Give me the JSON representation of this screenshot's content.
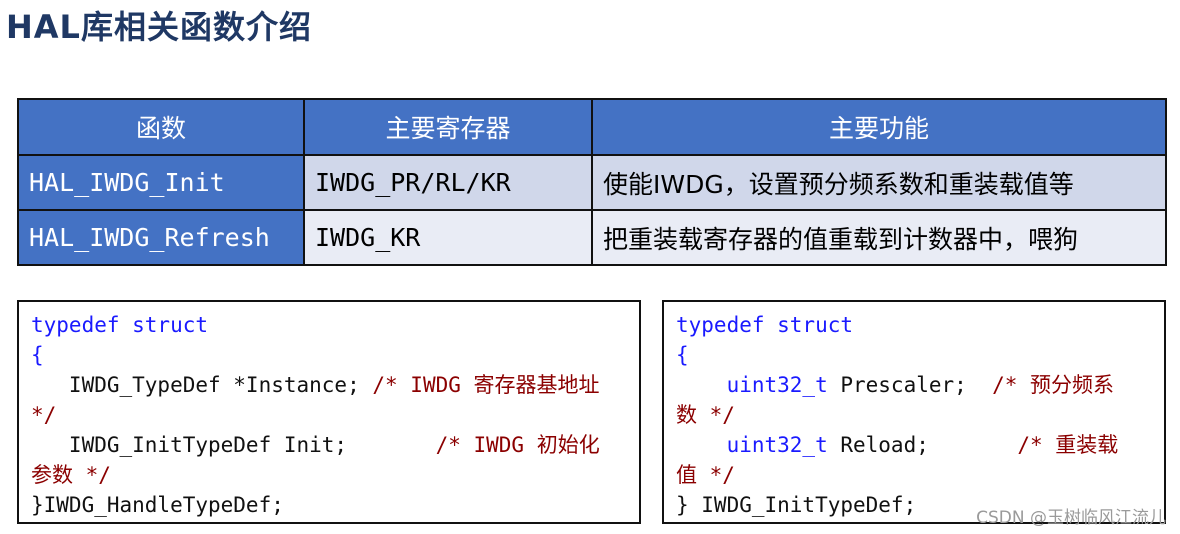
{
  "title": "HAL库相关函数介绍",
  "table": {
    "headers": [
      "函数",
      "主要寄存器",
      "主要功能"
    ],
    "rows": [
      [
        "HAL_IWDG_Init",
        "IWDG_PR/RL/KR",
        "使能IWDG，设置预分频系数和重装载值等"
      ],
      [
        "HAL_IWDG_Refresh",
        "IWDG_KR",
        "把重装载寄存器的值重载到计数器中，喂狗"
      ]
    ]
  },
  "code_left": {
    "l1_kw": "typedef struct",
    "l2": "{",
    "l3_code": "   IWDG_TypeDef *Instance; ",
    "l3_comment": "/* IWDG 寄存器基地址",
    "l4_comment": "*/",
    "l5_code": "   IWDG_InitTypeDef Init;       ",
    "l5_comment": "/* IWDG 初始化",
    "l6_comment": "参数 */",
    "l7": "}IWDG_HandleTypeDef;"
  },
  "code_right": {
    "l1_kw": "typedef struct",
    "l2": "{",
    "l3_type": "    uint32_t",
    "l3_code": " Prescaler;  ",
    "l3_comment": "/* 预分频系",
    "l4_comment": "数 */",
    "l5_type": "    uint32_t",
    "l5_code": " Reload;       ",
    "l5_comment": "/* 重装载",
    "l6_comment": "值 */",
    "l7": "} IWDG_InitTypeDef;"
  },
  "watermark": "CSDN @玉树临风江流儿",
  "colors": {
    "header_bg": "#4472c4",
    "title": "#1f3864",
    "keyword": "#1a1aff",
    "comment": "#8b0000"
  }
}
